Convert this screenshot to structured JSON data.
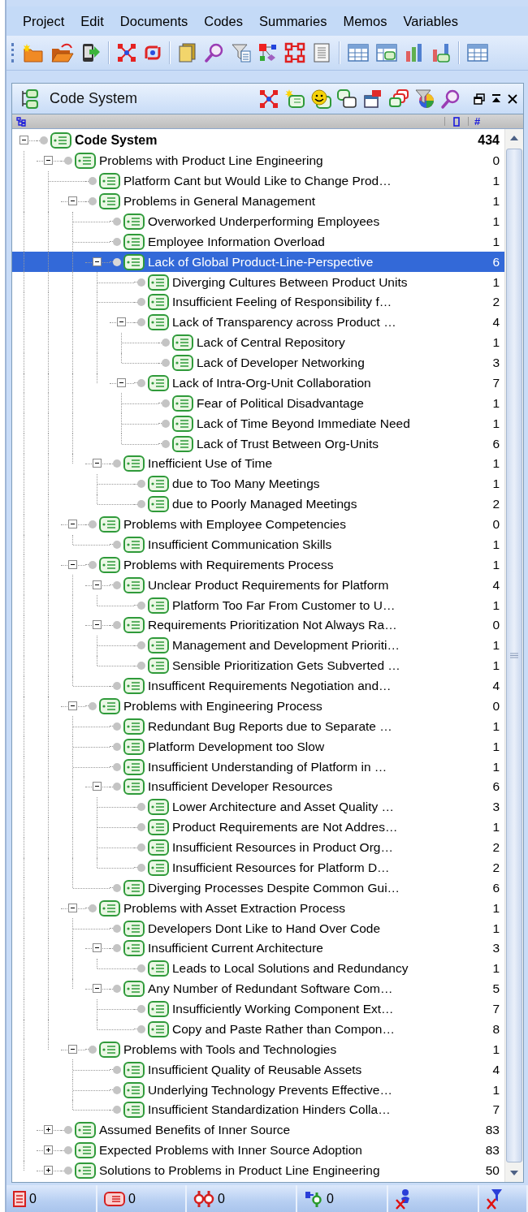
{
  "menu": [
    "Project",
    "Edit",
    "Documents",
    "Codes",
    "Summaries",
    "Memos",
    "Variables"
  ],
  "code_system": {
    "title": "Code System",
    "column_header": "#",
    "tree": {
      "label": "Code System",
      "count": "434",
      "expanded": true,
      "selected": false,
      "children": [
        {
          "label": "Problems with Product Line Engineering",
          "count": "0",
          "expanded": true,
          "selected": false,
          "children": [
            {
              "label": "Platform Cant but Would Like to Change Prod…",
              "count": "1",
              "selected": false
            },
            {
              "label": "Problems in General Management",
              "count": "1",
              "expanded": true,
              "selected": false,
              "children": [
                {
                  "label": "Overworked Underperforming Employees",
                  "count": "1",
                  "selected": false
                },
                {
                  "label": "Employee Information Overload",
                  "count": "1",
                  "selected": false
                },
                {
                  "label": "Lack of Global Product-Line-Perspective",
                  "count": "6",
                  "expanded": true,
                  "selected": true,
                  "children": [
                    {
                      "label": "Diverging Cultures Between Product Units",
                      "count": "1",
                      "selected": false
                    },
                    {
                      "label": "Insufficient Feeling of Responsibility f…",
                      "count": "2",
                      "selected": false
                    },
                    {
                      "label": "Lack of Transparency across Product …",
                      "count": "4",
                      "expanded": true,
                      "selected": false,
                      "children": [
                        {
                          "label": "Lack of Central Repository",
                          "count": "1",
                          "selected": false
                        },
                        {
                          "label": "Lack of Developer Networking",
                          "count": "3",
                          "selected": false
                        }
                      ]
                    },
                    {
                      "label": "Lack of Intra-Org-Unit Collaboration",
                      "count": "7",
                      "expanded": true,
                      "selected": false,
                      "children": [
                        {
                          "label": "Fear of Political Disadvantage",
                          "count": "1",
                          "selected": false
                        },
                        {
                          "label": "Lack of Time Beyond Immediate Need",
                          "count": "1",
                          "selected": false
                        },
                        {
                          "label": "Lack of Trust Between Org-Units",
                          "count": "6",
                          "selected": false
                        }
                      ]
                    }
                  ]
                },
                {
                  "label": "Inefficient Use of Time",
                  "count": "1",
                  "expanded": true,
                  "selected": false,
                  "children": [
                    {
                      "label": "due to Too Many Meetings",
                      "count": "1",
                      "selected": false
                    },
                    {
                      "label": "due to Poorly Managed Meetings",
                      "count": "2",
                      "selected": false
                    }
                  ]
                }
              ]
            },
            {
              "label": "Problems with Employee Competencies",
              "count": "0",
              "expanded": true,
              "selected": false,
              "children": [
                {
                  "label": "Insufficient Communication Skills",
                  "count": "1",
                  "selected": false
                }
              ]
            },
            {
              "label": "Problems with Requirements Process",
              "count": "1",
              "expanded": true,
              "selected": false,
              "children": [
                {
                  "label": "Unclear Product Requirements for Platform",
                  "count": "4",
                  "expanded": true,
                  "selected": false,
                  "children": [
                    {
                      "label": "Platform Too Far From Customer to U…",
                      "count": "1",
                      "selected": false
                    }
                  ]
                },
                {
                  "label": "Requirements Prioritization Not Always Ra…",
                  "count": "0",
                  "expanded": true,
                  "selected": false,
                  "children": [
                    {
                      "label": "Management and Development Prioriti…",
                      "count": "1",
                      "selected": false
                    },
                    {
                      "label": "Sensible Prioritization Gets Subverted …",
                      "count": "1",
                      "selected": false
                    }
                  ]
                },
                {
                  "label": "Insufficent Requirements Negotiation and…",
                  "count": "4",
                  "selected": false
                }
              ]
            },
            {
              "label": "Problems with Engineering Process",
              "count": "0",
              "expanded": true,
              "selected": false,
              "children": [
                {
                  "label": "Redundant Bug Reports due to Separate …",
                  "count": "1",
                  "selected": false
                },
                {
                  "label": "Platform Development too Slow",
                  "count": "1",
                  "selected": false
                },
                {
                  "label": "Insufficient Understanding of Platform in …",
                  "count": "1",
                  "selected": false
                },
                {
                  "label": "Insufficient Developer Resources",
                  "count": "6",
                  "expanded": true,
                  "selected": false,
                  "children": [
                    {
                      "label": "Lower Architecture and Asset Quality …",
                      "count": "3",
                      "selected": false
                    },
                    {
                      "label": "Product Requirements are Not Addres…",
                      "count": "1",
                      "selected": false
                    },
                    {
                      "label": "Insufficient Resources in Product Org…",
                      "count": "2",
                      "selected": false
                    },
                    {
                      "label": "Insufficient Resources for Platform D…",
                      "count": "2",
                      "selected": false
                    }
                  ]
                },
                {
                  "label": "Diverging Processes Despite Common Gui…",
                  "count": "6",
                  "selected": false
                }
              ]
            },
            {
              "label": "Problems with Asset Extraction Process",
              "count": "1",
              "expanded": true,
              "selected": false,
              "children": [
                {
                  "label": "Developers Dont Like to Hand Over Code",
                  "count": "1",
                  "selected": false
                },
                {
                  "label": "Insufficient Current Architecture",
                  "count": "3",
                  "expanded": true,
                  "selected": false,
                  "children": [
                    {
                      "label": "Leads to Local Solutions and Redundancy",
                      "count": "1",
                      "selected": false
                    }
                  ]
                },
                {
                  "label": "Any Number of Redundant Software Com…",
                  "count": "5",
                  "expanded": true,
                  "selected": false,
                  "children": [
                    {
                      "label": "Insufficiently Working Component Ext…",
                      "count": "7",
                      "selected": false
                    },
                    {
                      "label": "Copy and Paste Rather than Compon…",
                      "count": "8",
                      "selected": false
                    }
                  ]
                }
              ]
            },
            {
              "label": "Problems with Tools and Technologies",
              "count": "1",
              "expanded": true,
              "selected": false,
              "children": [
                {
                  "label": "Insufficient Quality of Reusable Assets",
                  "count": "4",
                  "selected": false
                },
                {
                  "label": "Underlying Technology Prevents Effective…",
                  "count": "1",
                  "selected": false
                },
                {
                  "label": "Insufficient Standardization Hinders Colla…",
                  "count": "7",
                  "selected": false
                }
              ]
            }
          ]
        },
        {
          "label": "Assumed Benefits of Inner Source",
          "count": "83",
          "expanded": false,
          "selected": false
        },
        {
          "label": "Expected Problems with Inner Source Adoption",
          "count": "83",
          "expanded": false,
          "selected": false
        },
        {
          "label": "Solutions to Problems in Product Line Engineering",
          "count": "50",
          "expanded": false,
          "selected": false
        }
      ]
    }
  },
  "status_bar": {
    "counts": [
      "0",
      "0",
      "0",
      "0"
    ]
  }
}
